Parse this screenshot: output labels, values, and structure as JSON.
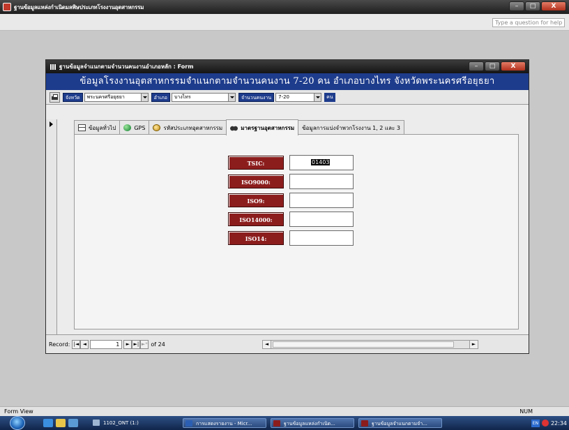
{
  "app": {
    "title": "ฐานข้อมูลแหล่งกำเนิดมลพิษประเภทโรงงานอุตสาหกรรม",
    "help_placeholder": "Type a question for help"
  },
  "window_controls": {
    "minimize": "–",
    "maximize": "□",
    "close": "X"
  },
  "form": {
    "title": "ฐานข้อมูลจำแนกตามจำนวนคนงานอำเภอหลัก : Form",
    "banner": "ข้อมูลโรงงานอุตสาหกรรมจำแนกตามจำนวนคนงาน 7-20 คน อำเภอบางไทร จังหวัดพระนครศรีอยุธยา",
    "filters": {
      "province_label": "จังหวัด",
      "province_value": "พระนครศรีอยุธยา",
      "district_label": "อำเภอ",
      "district_value": "บางไทร",
      "workers_label": "จำนวนคนงาน",
      "workers_value": "7-20",
      "workers_unit": "คน"
    },
    "tabs": [
      {
        "label": "ข้อมูลทั่วไป",
        "icon": "general-info-icon"
      },
      {
        "label": "GPS",
        "icon": "gps-icon"
      },
      {
        "label": "รหัสประเภทอุตสาหกรรม",
        "icon": "industry-code-icon"
      },
      {
        "label": "มาตรฐานอุตสาหกรรม",
        "icon": "binoculars-icon",
        "active": true
      },
      {
        "label": "ข้อมูลการแบ่งจำพวกโรงงาน 1, 2 และ 3"
      }
    ],
    "standards": [
      {
        "label": "TSIC:",
        "value": "01403"
      },
      {
        "label": "ISO9000:",
        "value": ""
      },
      {
        "label": "ISO9:",
        "value": ""
      },
      {
        "label": "ISO14000:",
        "value": ""
      },
      {
        "label": "ISO14:",
        "value": ""
      }
    ],
    "navigation": {
      "record_label": "Record:",
      "first": "|◄",
      "prev": "◄",
      "current": "1",
      "next": "►",
      "last": "►|",
      "new": "►*",
      "of_text": "of 24"
    }
  },
  "status": {
    "left": "Form View",
    "right": "NUM"
  },
  "taskbar": {
    "items": [
      {
        "label": "1102_ONT (1:)"
      },
      {
        "label": "การแสดงรายงาน - Micr..."
      },
      {
        "label": "ฐานข้อมูลแหล่งกำเนิด..."
      },
      {
        "label": "ฐานข้อมูลจำแนกตามจำ..."
      }
    ],
    "lang": "EN",
    "clock": "22:34"
  }
}
